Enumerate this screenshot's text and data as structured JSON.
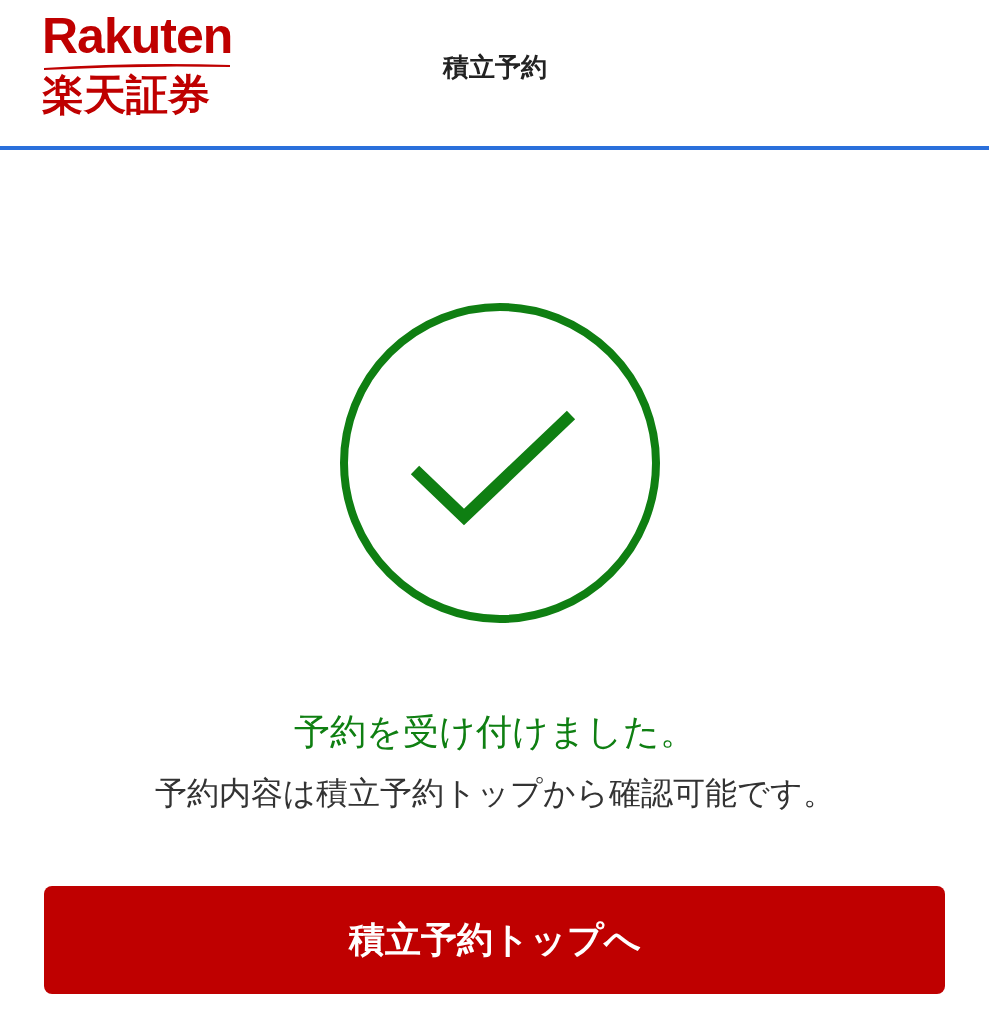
{
  "header": {
    "logo": {
      "brand": "Rakuten",
      "name": "楽天証券"
    },
    "title": "積立予約"
  },
  "result": {
    "message": "予約を受け付けました。",
    "note": "予約内容は積立予約トップから確認可能です。"
  },
  "button": {
    "label": "積立予約トップへ"
  }
}
